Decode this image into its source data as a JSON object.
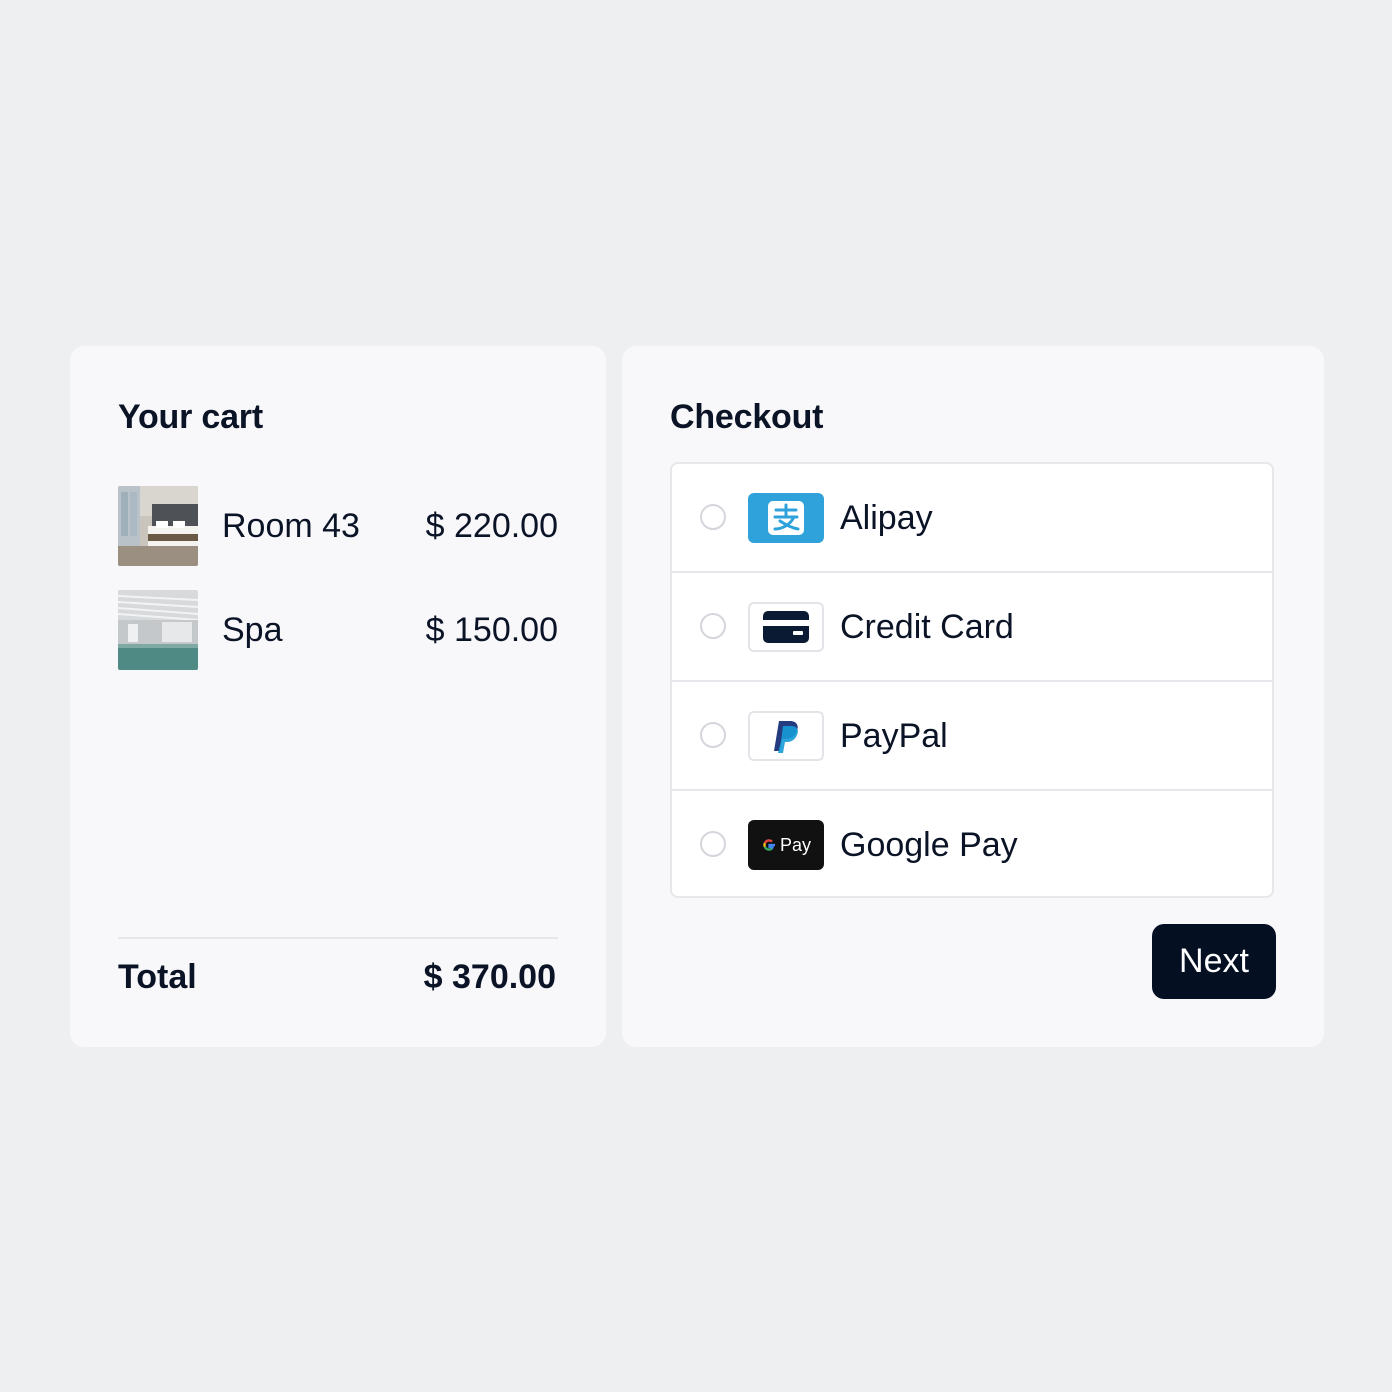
{
  "cart": {
    "title": "Your cart",
    "items": [
      {
        "name": "Room 43",
        "price": "$ 220.00",
        "image": "hotel-room-photo"
      },
      {
        "name": "Spa",
        "price": "$ 150.00",
        "image": "spa-pool-photo"
      }
    ],
    "total_label": "Total",
    "total_value": "$ 370.00"
  },
  "checkout": {
    "title": "Checkout",
    "methods": [
      {
        "label": "Alipay",
        "icon": "alipay-icon",
        "selected": false
      },
      {
        "label": "Credit Card",
        "icon": "credit-card-icon",
        "selected": false
      },
      {
        "label": "PayPal",
        "icon": "paypal-icon",
        "selected": false
      },
      {
        "label": "Google Pay",
        "icon": "google-pay-icon",
        "selected": false
      }
    ],
    "next_label": "Next",
    "gpay_logo_text": "Pay"
  },
  "colors": {
    "page_background": "#eeeff1",
    "card_background": "#f8f8fa",
    "text": "#0b1426",
    "button": "#040f22",
    "alipay_blue": "#2fa2dc"
  }
}
